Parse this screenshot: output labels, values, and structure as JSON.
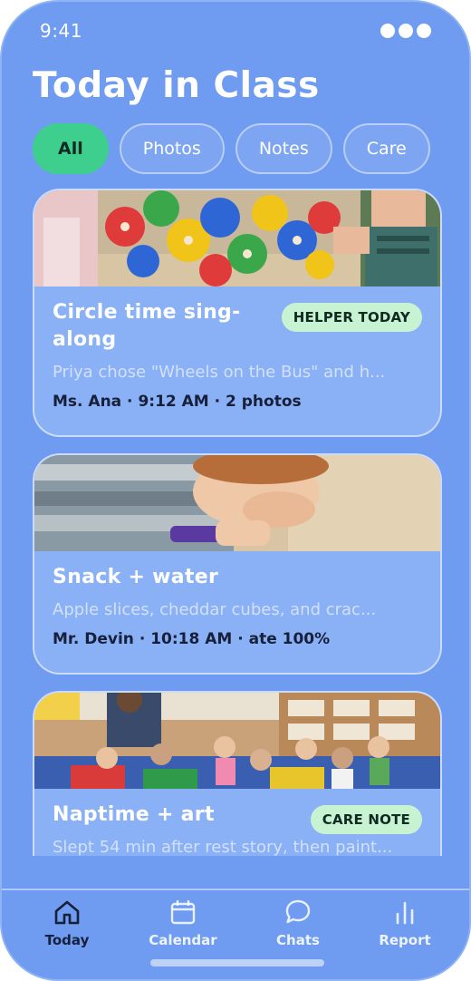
{
  "status_bar": {
    "time": "9:41"
  },
  "header": {
    "title": "Today in Class"
  },
  "filters": [
    {
      "label": "All",
      "active": true
    },
    {
      "label": "Photos",
      "active": false
    },
    {
      "label": "Notes",
      "active": false
    },
    {
      "label": "Care",
      "active": false
    }
  ],
  "feed": [
    {
      "title": "Circle time sing-along",
      "badge": "HELPER TODAY",
      "preview": "Priya chose \"Wheels on the Bus\" and h...",
      "meta": "Ms. Ana · 9:12 AM · 2 photos"
    },
    {
      "title": "Snack + water",
      "preview": "Apple slices, cheddar cubes, and crac...",
      "meta": "Mr. Devin · 10:18 AM · ate 100%"
    },
    {
      "title": "Naptime + art",
      "badge": "CARE NOTE",
      "preview": "Slept 54 min after rest story, then paint...",
      "meta": ""
    }
  ],
  "tab_bar": [
    {
      "label": "Today",
      "icon": "home-icon",
      "active": true
    },
    {
      "label": "Calendar",
      "icon": "calendar-icon",
      "active": false
    },
    {
      "label": "Chats",
      "icon": "chat-bubble-icon",
      "active": false
    },
    {
      "label": "Report",
      "icon": "bar-chart-icon",
      "active": false
    }
  ],
  "colors": {
    "background": "#6f9bf0",
    "card": "#8ab0f5",
    "accent_green": "#3ecf8e",
    "badge_green": "#c7f3d3",
    "dark_text": "#17203a"
  }
}
